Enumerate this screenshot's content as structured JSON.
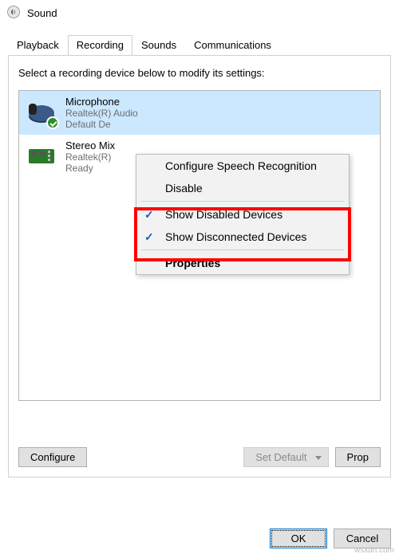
{
  "window": {
    "title": "Sound"
  },
  "tabs": [
    "Playback",
    "Recording",
    "Sounds",
    "Communications"
  ],
  "active_tab_index": 1,
  "instruction": "Select a recording device below to modify its settings:",
  "devices": [
    {
      "name": "Microphone",
      "driver": "Realtek(R) Audio",
      "status": "Default De",
      "selected": true,
      "badge": "default"
    },
    {
      "name": "Stereo Mix",
      "driver": "Realtek(R)",
      "status": "Ready",
      "selected": false
    }
  ],
  "context_menu": {
    "configure": "Configure Speech Recognition",
    "disable": "Disable",
    "show_disabled": "Show Disabled Devices",
    "show_disconnected": "Show Disconnected Devices",
    "properties": "Properties"
  },
  "buttons": {
    "configure": "Configure",
    "set_default": "Set Default",
    "properties": "Prop",
    "ok": "OK",
    "cancel": "Cancel"
  },
  "watermark": "wsxdn.com"
}
